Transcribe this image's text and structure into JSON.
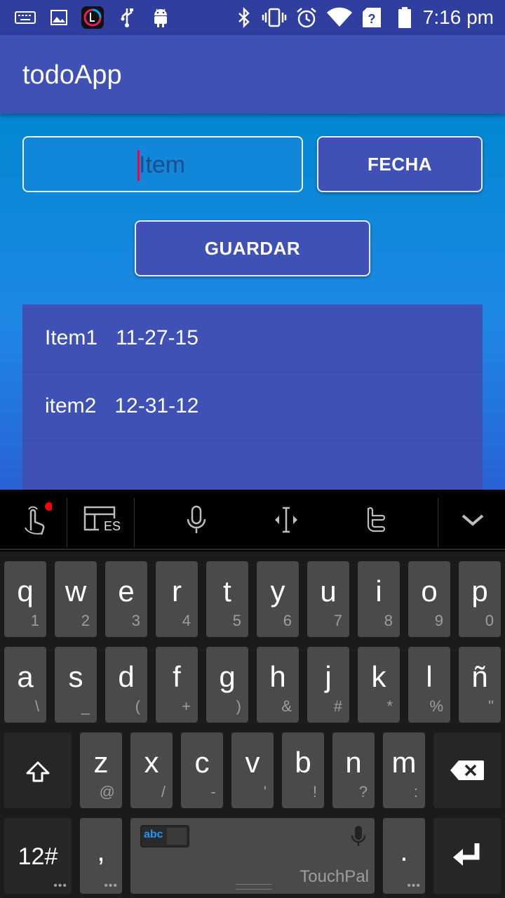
{
  "status_bar": {
    "time": "7:16 pm",
    "icons": [
      "keyboard-icon",
      "image-icon",
      "app-icon",
      "usb-icon",
      "android-icon",
      "bluetooth-icon",
      "vibrate-icon",
      "alarm-icon",
      "wifi-icon",
      "signal-icon",
      "battery-icon"
    ]
  },
  "app_bar": {
    "title": "todoApp"
  },
  "form": {
    "item_placeholder": "Item",
    "fecha_label": "FECHA",
    "guardar_label": "GUARDAR"
  },
  "list": {
    "items": [
      {
        "name": "Item1",
        "date": "11-27-15"
      },
      {
        "name": "item2",
        "date": "12-31-12"
      }
    ]
  },
  "keyboard": {
    "toolbar": {
      "language": "ES"
    },
    "row1": [
      {
        "main": "q",
        "sub": "1"
      },
      {
        "main": "w",
        "sub": "2"
      },
      {
        "main": "e",
        "sub": "3"
      },
      {
        "main": "r",
        "sub": "4"
      },
      {
        "main": "t",
        "sub": "5"
      },
      {
        "main": "y",
        "sub": "6"
      },
      {
        "main": "u",
        "sub": "7"
      },
      {
        "main": "i",
        "sub": "8"
      },
      {
        "main": "o",
        "sub": "9"
      },
      {
        "main": "p",
        "sub": "0"
      }
    ],
    "row2": [
      {
        "main": "a",
        "sub": "\\"
      },
      {
        "main": "s",
        "sub": "_"
      },
      {
        "main": "d",
        "sub": "("
      },
      {
        "main": "f",
        "sub": "+"
      },
      {
        "main": "g",
        "sub": ")"
      },
      {
        "main": "h",
        "sub": "&"
      },
      {
        "main": "j",
        "sub": "#"
      },
      {
        "main": "k",
        "sub": "*"
      },
      {
        "main": "l",
        "sub": "%"
      },
      {
        "main": "ñ",
        "sub": "\""
      }
    ],
    "row3": [
      {
        "main": "z",
        "sub": "@"
      },
      {
        "main": "x",
        "sub": "/"
      },
      {
        "main": "c",
        "sub": "-"
      },
      {
        "main": "v",
        "sub": "'"
      },
      {
        "main": "b",
        "sub": "!"
      },
      {
        "main": "n",
        "sub": "?"
      },
      {
        "main": "m",
        "sub": ":"
      }
    ],
    "symbols_label": "12#",
    "comma_label": ",",
    "period_label": ".",
    "space_mode": "abc",
    "space_brand": "TouchPal"
  }
}
